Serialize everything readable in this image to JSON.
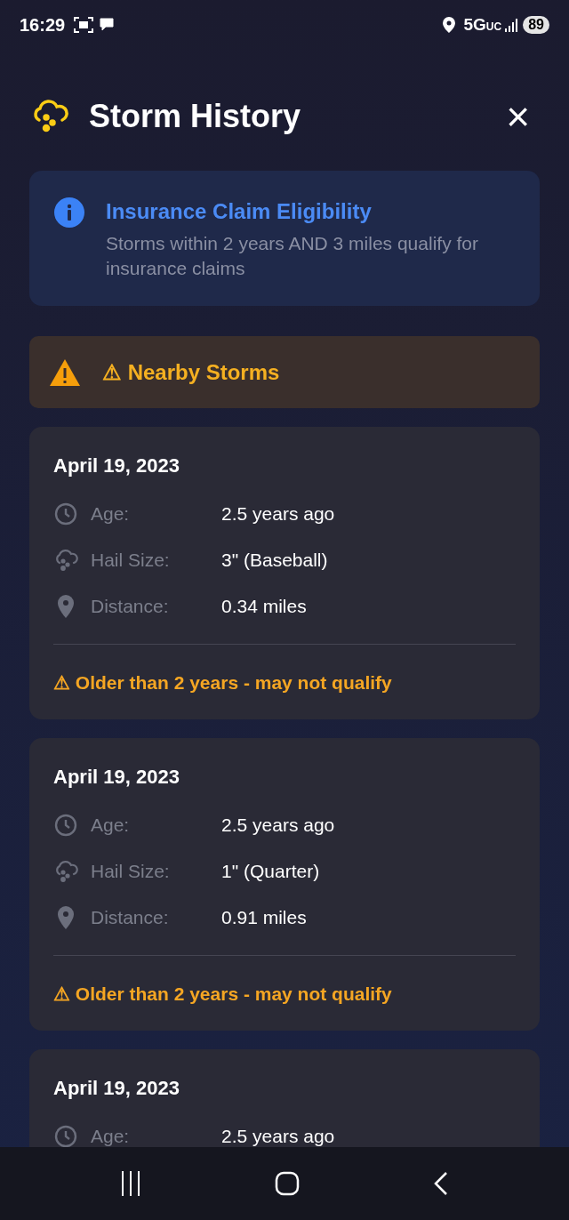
{
  "status_bar": {
    "time": "16:29",
    "network": "5G",
    "network_suffix": "UC",
    "battery": "89"
  },
  "header": {
    "title": "Storm History",
    "close": "×"
  },
  "info_card": {
    "title": "Insurance Claim Eligibility",
    "text": "Storms within 2 years AND 3 miles qualify for insurance claims"
  },
  "section": {
    "title": "⚠ Nearby Storms"
  },
  "storms": [
    {
      "date": "April 19, 2023",
      "rows": [
        {
          "kind": "age",
          "label": "Age:",
          "value": "2.5 years ago"
        },
        {
          "kind": "hail",
          "label": "Hail Size:",
          "value": "3\" (Baseball)"
        },
        {
          "kind": "distance",
          "label": "Distance:",
          "value": "0.34 miles"
        }
      ],
      "warning": "⚠ Older than 2 years - may not qualify"
    },
    {
      "date": "April 19, 2023",
      "rows": [
        {
          "kind": "age",
          "label": "Age:",
          "value": "2.5 years ago"
        },
        {
          "kind": "hail",
          "label": "Hail Size:",
          "value": "1\" (Quarter)"
        },
        {
          "kind": "distance",
          "label": "Distance:",
          "value": "0.91 miles"
        }
      ],
      "warning": "⚠ Older than 2 years - may not qualify"
    },
    {
      "date": "April 19, 2023",
      "rows": [
        {
          "kind": "age",
          "label": "Age:",
          "value": "2.5 years ago"
        }
      ]
    }
  ]
}
